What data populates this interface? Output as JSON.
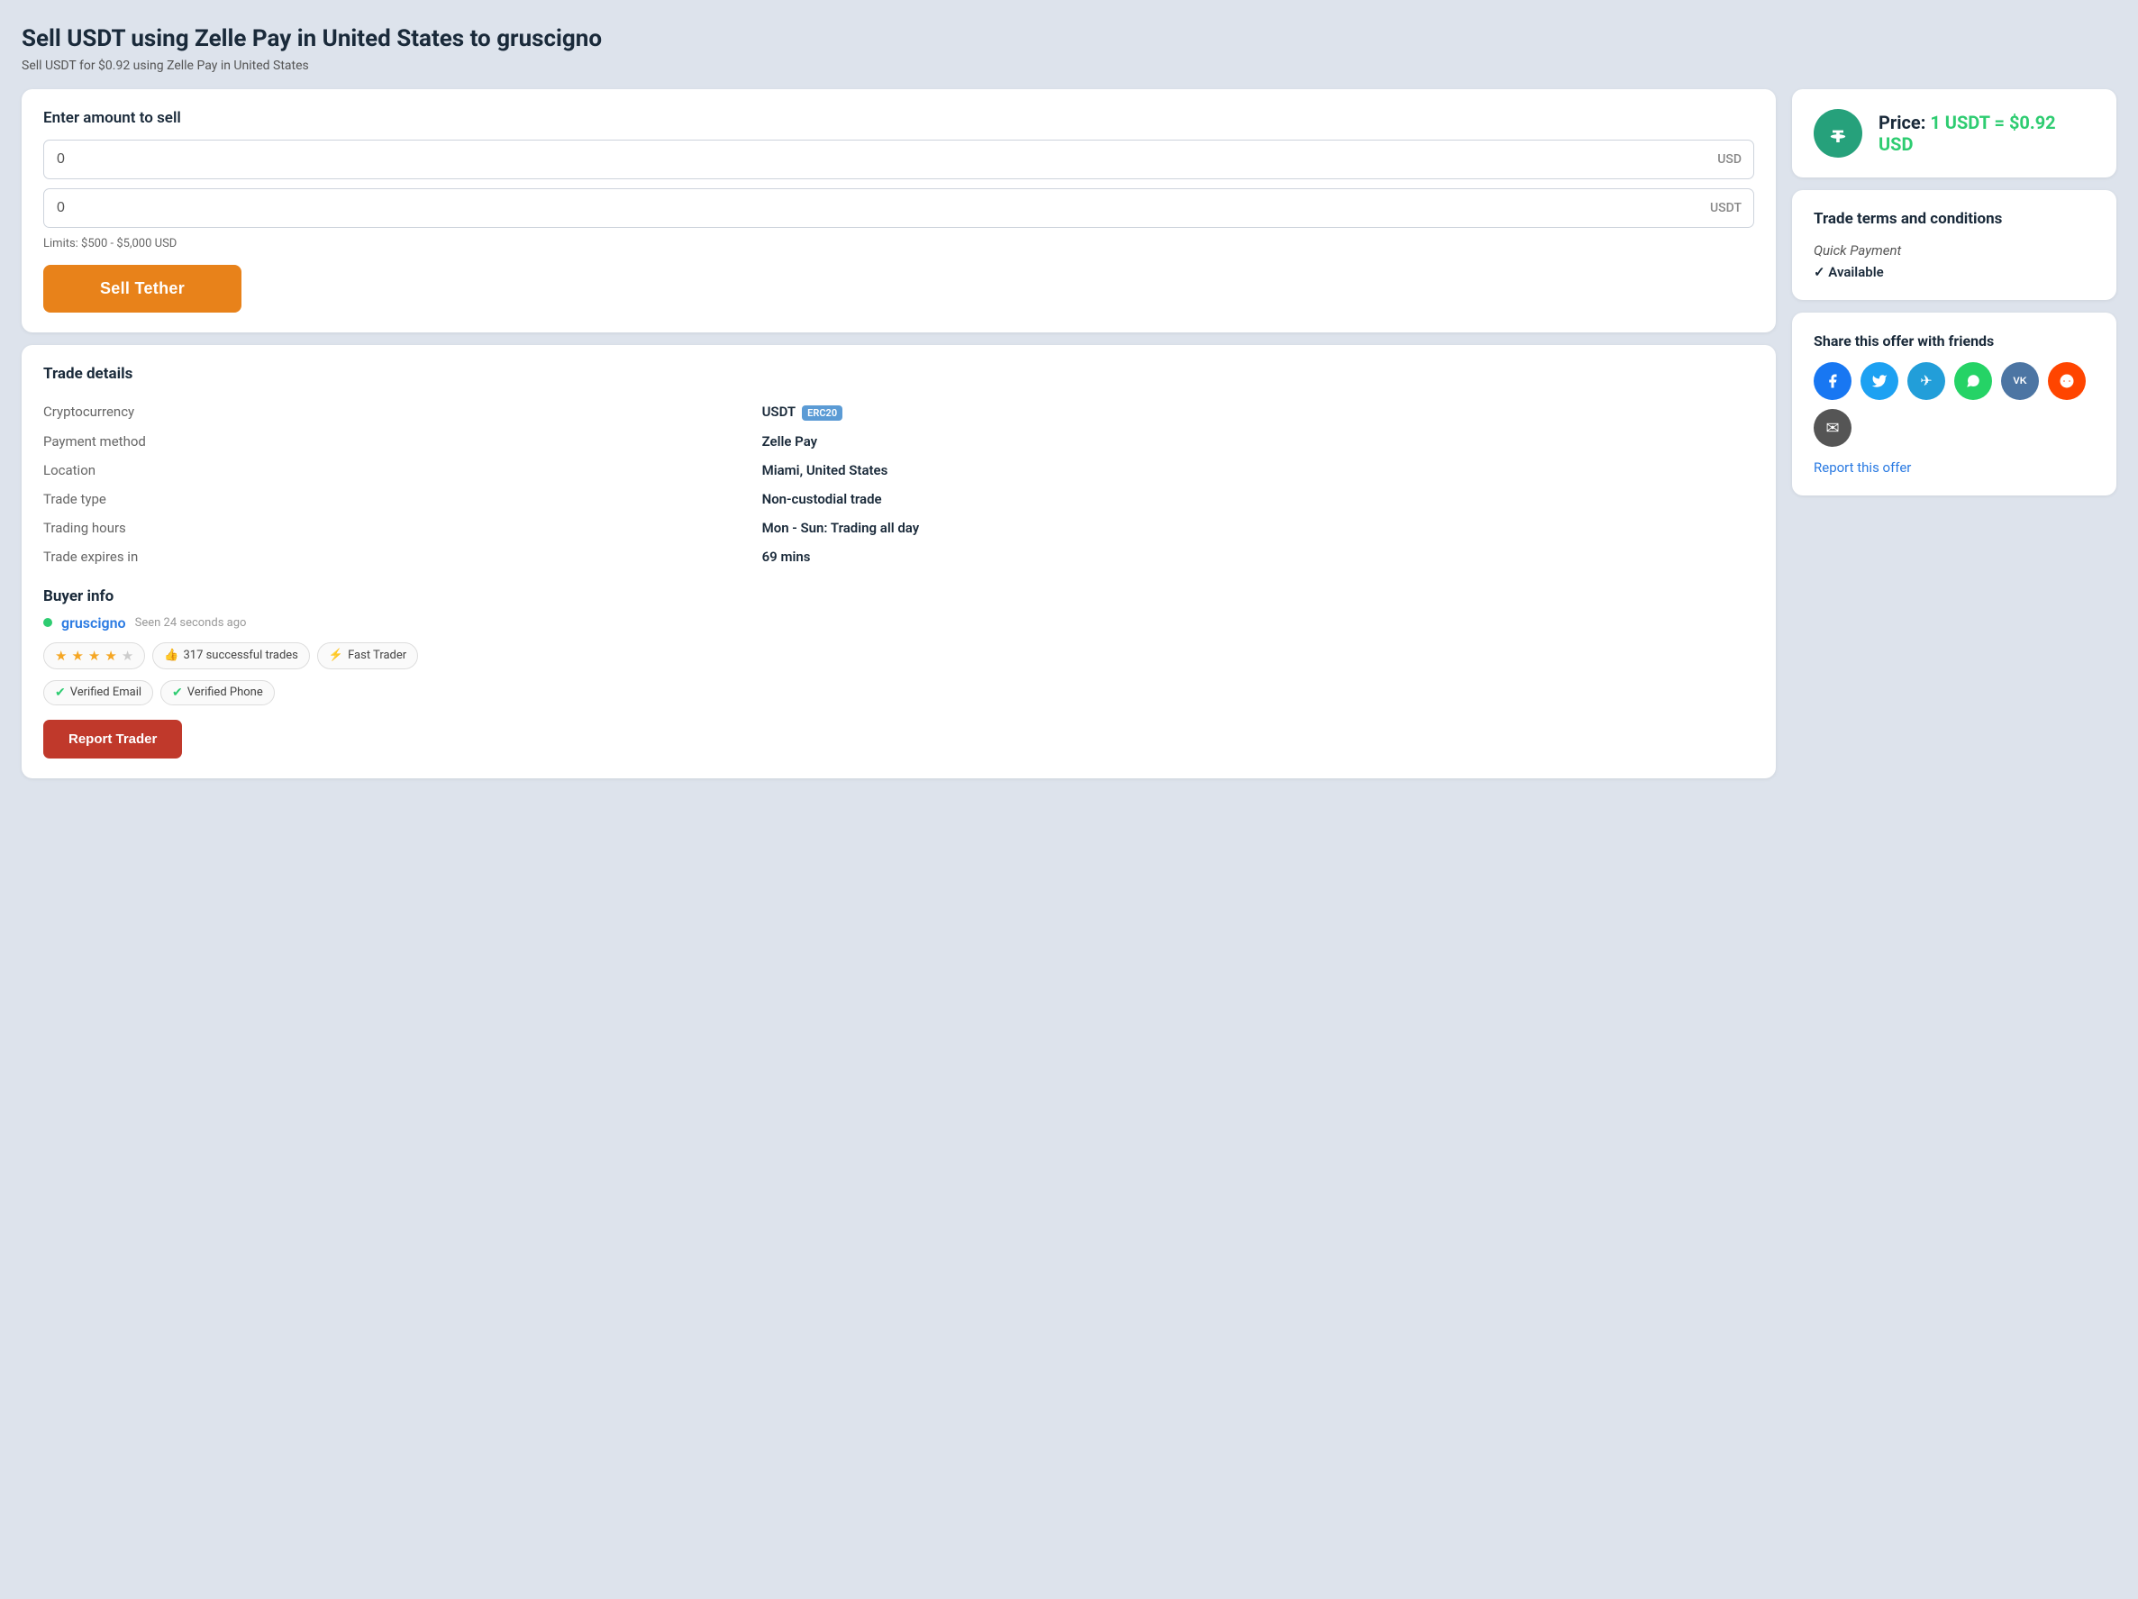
{
  "page": {
    "title": "Sell USDT using Zelle Pay in United States to gruscigno",
    "subtitle": "Sell USDT for $0.92 using Zelle Pay in United States"
  },
  "amount_form": {
    "label": "Enter amount to sell",
    "usd_value": "0",
    "usd_suffix": "USD",
    "usdt_value": "0",
    "usdt_suffix": "USDT",
    "limits": "Limits: $500 - $5,000 USD",
    "sell_button": "Sell Tether"
  },
  "trade_details": {
    "title": "Trade details",
    "rows": [
      {
        "label": "Cryptocurrency",
        "value": "USDT",
        "badge": "ERC20"
      },
      {
        "label": "Payment method",
        "value": "Zelle Pay"
      },
      {
        "label": "Location",
        "value": "Miami, United States"
      },
      {
        "label": "Trade type",
        "value": "Non-custodial trade"
      },
      {
        "label": "Trading hours",
        "value": "Mon - Sun: Trading all day"
      },
      {
        "label": "Trade expires in",
        "value": "69 mins"
      }
    ]
  },
  "buyer_info": {
    "title": "Buyer info",
    "username": "gruscigno",
    "seen": "Seen 24 seconds ago",
    "stars": 4,
    "successful_trades": "317 successful trades",
    "fast_trader": "Fast Trader",
    "verified_email": "Verified Email",
    "verified_phone": "Verified Phone",
    "report_button": "Report Trader"
  },
  "price_card": {
    "label": "Price:",
    "price_text": "1 USDT = $0.92 USD"
  },
  "terms_card": {
    "title": "Trade terms and conditions",
    "condition": "Quick Payment",
    "available": "✓ Available"
  },
  "share_card": {
    "title": "Share this offer with friends",
    "report_link": "Report this offer",
    "social_buttons": [
      {
        "name": "facebook",
        "label": "f"
      },
      {
        "name": "twitter",
        "label": "t"
      },
      {
        "name": "telegram",
        "label": "✈"
      },
      {
        "name": "whatsapp",
        "label": "w"
      },
      {
        "name": "vk",
        "label": "vk"
      },
      {
        "name": "reddit",
        "label": "r"
      },
      {
        "name": "email",
        "label": "✉"
      }
    ]
  }
}
